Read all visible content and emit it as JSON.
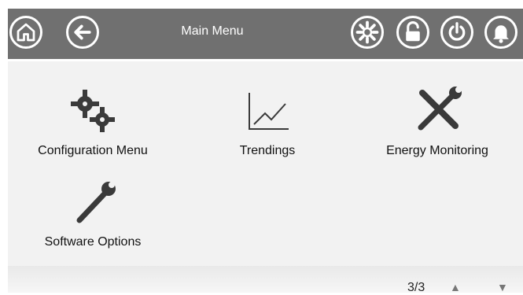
{
  "header": {
    "title": "Main Menu",
    "icons": {
      "home": "home-icon",
      "back": "back-arrow-icon",
      "settings": "gear-icon",
      "lock": "unlock-icon",
      "power": "power-icon",
      "alarm": "bell-icon"
    }
  },
  "menu": {
    "items": [
      {
        "label": "Configuration Menu",
        "icon": "gears-icon"
      },
      {
        "label": "Trendings",
        "icon": "line-chart-icon"
      },
      {
        "label": "Energy Monitoring",
        "icon": "tools-icon"
      },
      {
        "label": "Software Options",
        "icon": "wrench-icon"
      }
    ]
  },
  "footer": {
    "page_indicator": "3/3",
    "up_arrow": "▲",
    "down_arrow": "▼"
  },
  "colors": {
    "header": "#707070",
    "content_bg": "#f2f2f2",
    "icon": "#3a3a3a"
  }
}
